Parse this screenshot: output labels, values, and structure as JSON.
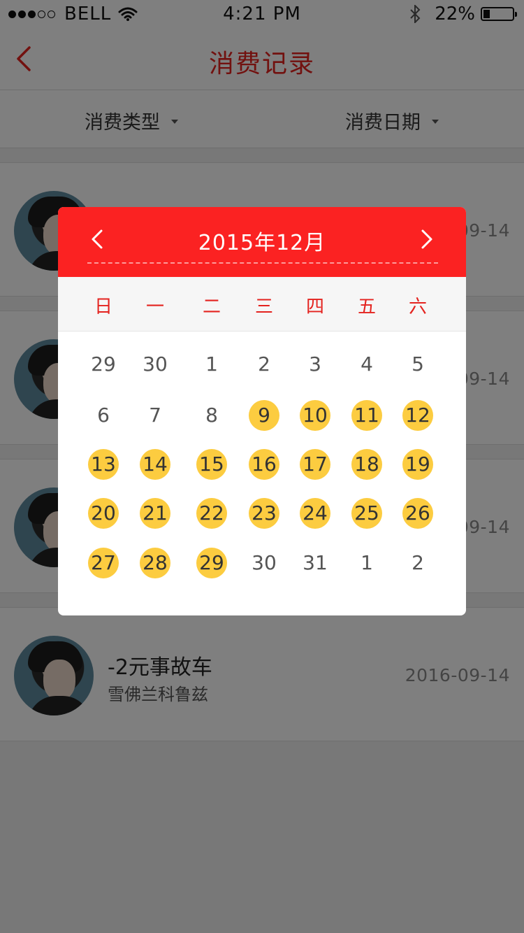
{
  "status_bar": {
    "carrier": "BELL",
    "time": "4:21 PM",
    "battery_percent": "22%",
    "battery_level": 0.22,
    "signal_bars_filled": 3,
    "signal_bars_total": 5,
    "icons": [
      "wifi-icon",
      "bluetooth-icon",
      "battery-icon"
    ]
  },
  "nav": {
    "title": "消费记录",
    "back_icon": "chevron-left-icon",
    "accent_color": "#e4231f"
  },
  "filters": {
    "type_label": "消费类型",
    "date_label": "消费日期"
  },
  "records": [
    {
      "title": "",
      "subtitle": "",
      "date": "09-14"
    },
    {
      "title": "",
      "subtitle": "",
      "date": "09-14"
    },
    {
      "title": "",
      "subtitle": "",
      "date": "09-14"
    },
    {
      "title": "-2元事故车",
      "subtitle": "雪佛兰科鲁兹",
      "date": "2016-09-14"
    }
  ],
  "calendar": {
    "title": "2015年12月",
    "header_color": "#fb2222",
    "highlight_color": "#fccc40",
    "weekdays": [
      "日",
      "一",
      "二",
      "三",
      "四",
      "五",
      "六"
    ],
    "weeks": [
      [
        {
          "d": "29",
          "hl": false
        },
        {
          "d": "30",
          "hl": false
        },
        {
          "d": "1",
          "hl": false
        },
        {
          "d": "2",
          "hl": false
        },
        {
          "d": "3",
          "hl": false
        },
        {
          "d": "4",
          "hl": false
        },
        {
          "d": "5",
          "hl": false
        }
      ],
      [
        {
          "d": "6",
          "hl": false
        },
        {
          "d": "7",
          "hl": false
        },
        {
          "d": "8",
          "hl": false
        },
        {
          "d": "9",
          "hl": true
        },
        {
          "d": "10",
          "hl": true
        },
        {
          "d": "11",
          "hl": true
        },
        {
          "d": "12",
          "hl": true
        }
      ],
      [
        {
          "d": "13",
          "hl": true
        },
        {
          "d": "14",
          "hl": true
        },
        {
          "d": "15",
          "hl": true
        },
        {
          "d": "16",
          "hl": true
        },
        {
          "d": "17",
          "hl": true
        },
        {
          "d": "18",
          "hl": true
        },
        {
          "d": "19",
          "hl": true
        }
      ],
      [
        {
          "d": "20",
          "hl": true
        },
        {
          "d": "21",
          "hl": true
        },
        {
          "d": "22",
          "hl": true
        },
        {
          "d": "23",
          "hl": true
        },
        {
          "d": "24",
          "hl": true
        },
        {
          "d": "25",
          "hl": true
        },
        {
          "d": "26",
          "hl": true
        }
      ],
      [
        {
          "d": "27",
          "hl": true
        },
        {
          "d": "28",
          "hl": true
        },
        {
          "d": "29",
          "hl": true
        },
        {
          "d": "30",
          "hl": false
        },
        {
          "d": "31",
          "hl": false
        },
        {
          "d": "1",
          "hl": false
        },
        {
          "d": "2",
          "hl": false
        }
      ]
    ]
  }
}
